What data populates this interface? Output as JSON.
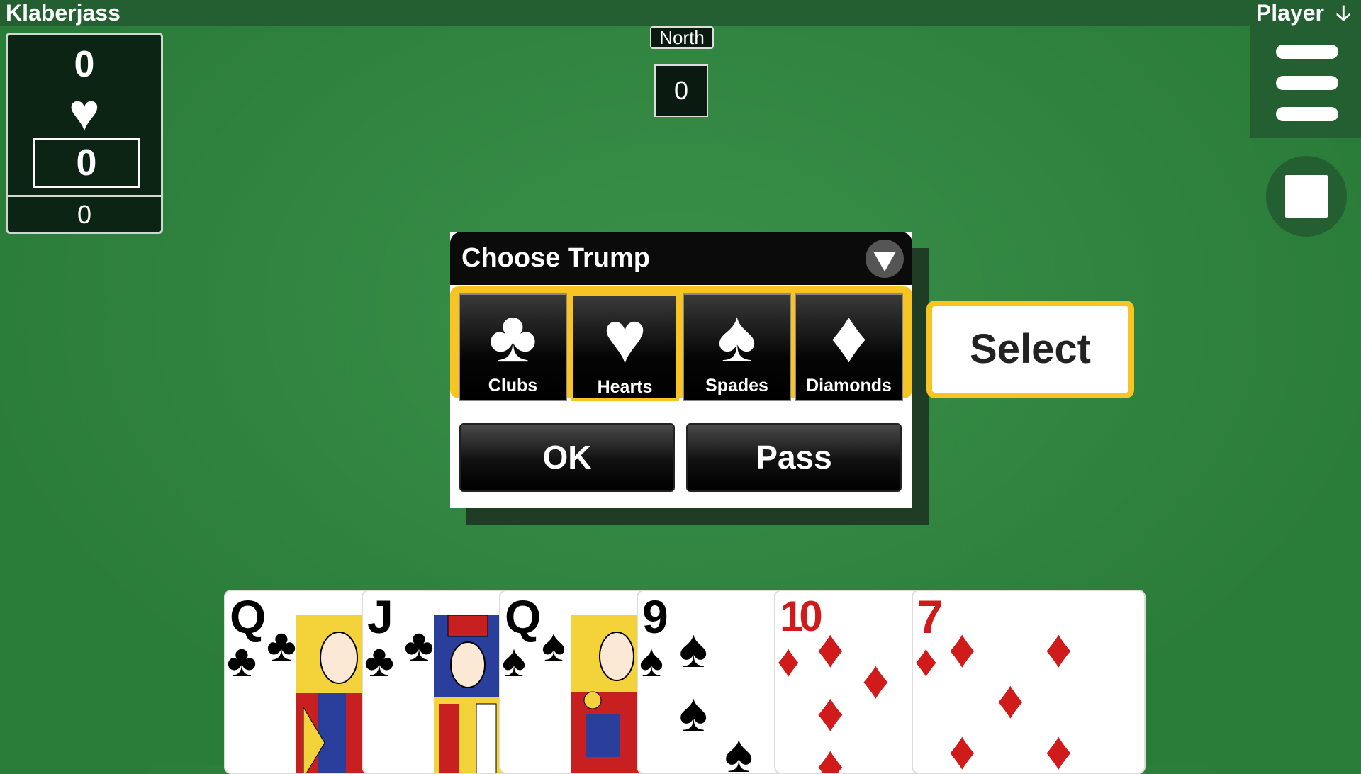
{
  "app": {
    "title": "Klaberjass",
    "player_label": "Player",
    "player_arrow": "🡣"
  },
  "score_panel": {
    "top_score": "0",
    "trump_suit": "♥",
    "boxed_score": "0",
    "bottom_score": "0"
  },
  "north": {
    "label": "North",
    "score": "0"
  },
  "dialog": {
    "title": "Choose Trump",
    "suits": [
      {
        "name": "Clubs",
        "glyph": "♣",
        "selected": false
      },
      {
        "name": "Hearts",
        "glyph": "♥",
        "selected": true
      },
      {
        "name": "Spades",
        "glyph": "♠",
        "selected": false
      },
      {
        "name": "Diamonds",
        "glyph": "♦",
        "selected": false
      }
    ],
    "ok_label": "OK",
    "pass_label": "Pass"
  },
  "select_label": "Select",
  "hand": [
    {
      "rank": "Q",
      "suit": "♣",
      "color": "#000000"
    },
    {
      "rank": "J",
      "suit": "♣",
      "color": "#000000"
    },
    {
      "rank": "Q",
      "suit": "♠",
      "color": "#000000"
    },
    {
      "rank": "9",
      "suit": "♠",
      "color": "#000000"
    },
    {
      "rank": "10",
      "suit": "♦",
      "color": "#d11a1a"
    },
    {
      "rank": "7",
      "suit": "♦",
      "color": "#d11a1a"
    }
  ],
  "colors": {
    "felt": "#2f8a3f",
    "accent": "#f8c423",
    "dark": "#0b0b0b"
  }
}
